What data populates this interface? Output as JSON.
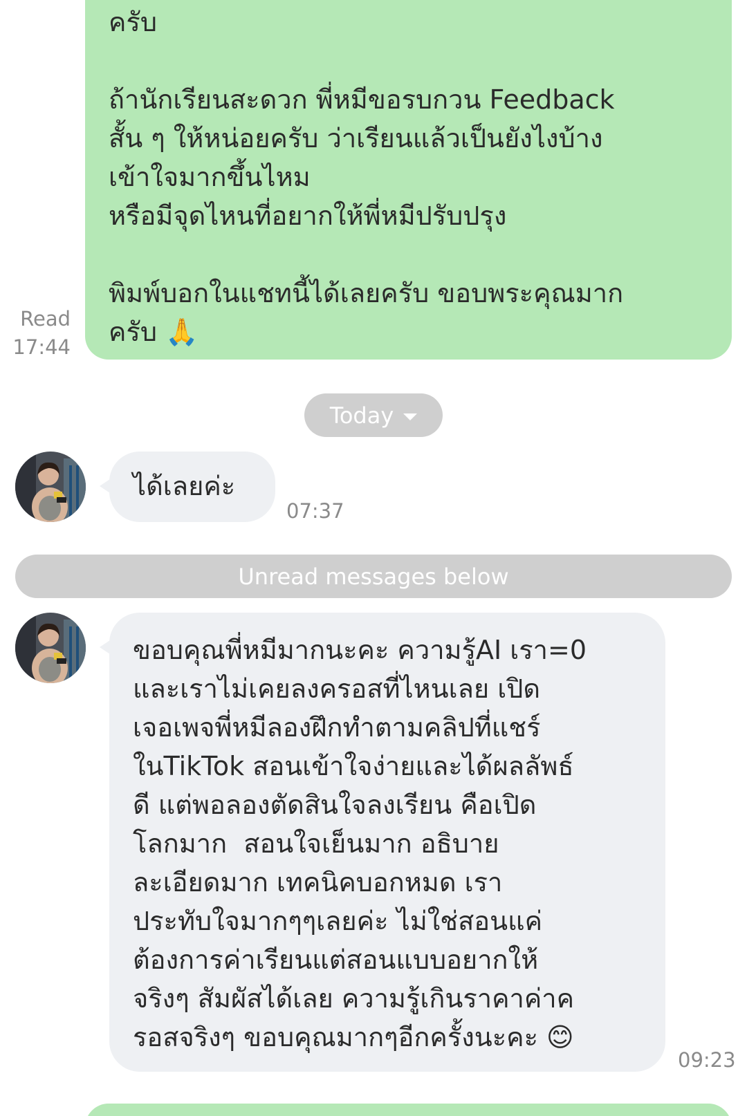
{
  "messages": {
    "outgoing_1": {
      "text": "ครับ\n\nถ้านักเรียนสะดวก พี่หมีขอรบกวน Feedback\nสั้น ๆ ให้หน่อยครับ ว่าเรียนแล้วเป็นยังไงบ้าง\nเข้าใจมากขึ้นไหม\nหรือมีจุดไหนที่อยากให้พี่หมีปรับปรุง\n\nพิมพ์บอกในแชทนี้ได้เลยครับ ขอบพระคุณมาก\nครับ 🙏",
      "read_label": "Read",
      "time": "17:44"
    },
    "incoming_1": {
      "text": "ได้เลยค่ะ",
      "time": "07:37"
    },
    "incoming_2": {
      "text": "ขอบคุณพี่หมีมากนะคะ ความรู้AI เรา=0\nและเราไม่เคยลงครอสที่ไหนเลย เปิด\nเจอเพจพี่หมีลองฝึกทำตามคลิปที่แชร์\nในTikTok สอนเข้าใจง่ายและได้ผลลัพธ์\nดี แต่พอลองตัดสินใจลงเรียน คือเปิด\nโลกมาก  สอนใจเย็นมาก อธิบาย\nละเอียดมาก เทคนิคบอกหมด เรา\nประทับใจมากๆๆเลยค่ะ ไม่ใช่สอนแค่\nต้องการค่าเรียนแต่สอนแบบอยากให้\nจริงๆ สัมผัสได้เลย ความรู้เกินราคาค่าค\nรอสจริงๆ ขอบคุณมากๆอีกครั้งนะคะ 😊",
      "time": "09:23"
    }
  },
  "separators": {
    "today_label": "Today",
    "unread_label": "Unread messages below"
  },
  "colors": {
    "outgoing_bubble": "#b5e8b6",
    "incoming_bubble": "#eef0f3",
    "separator_pill": "#cfcfcf",
    "meta_text": "#8a8a8a"
  }
}
